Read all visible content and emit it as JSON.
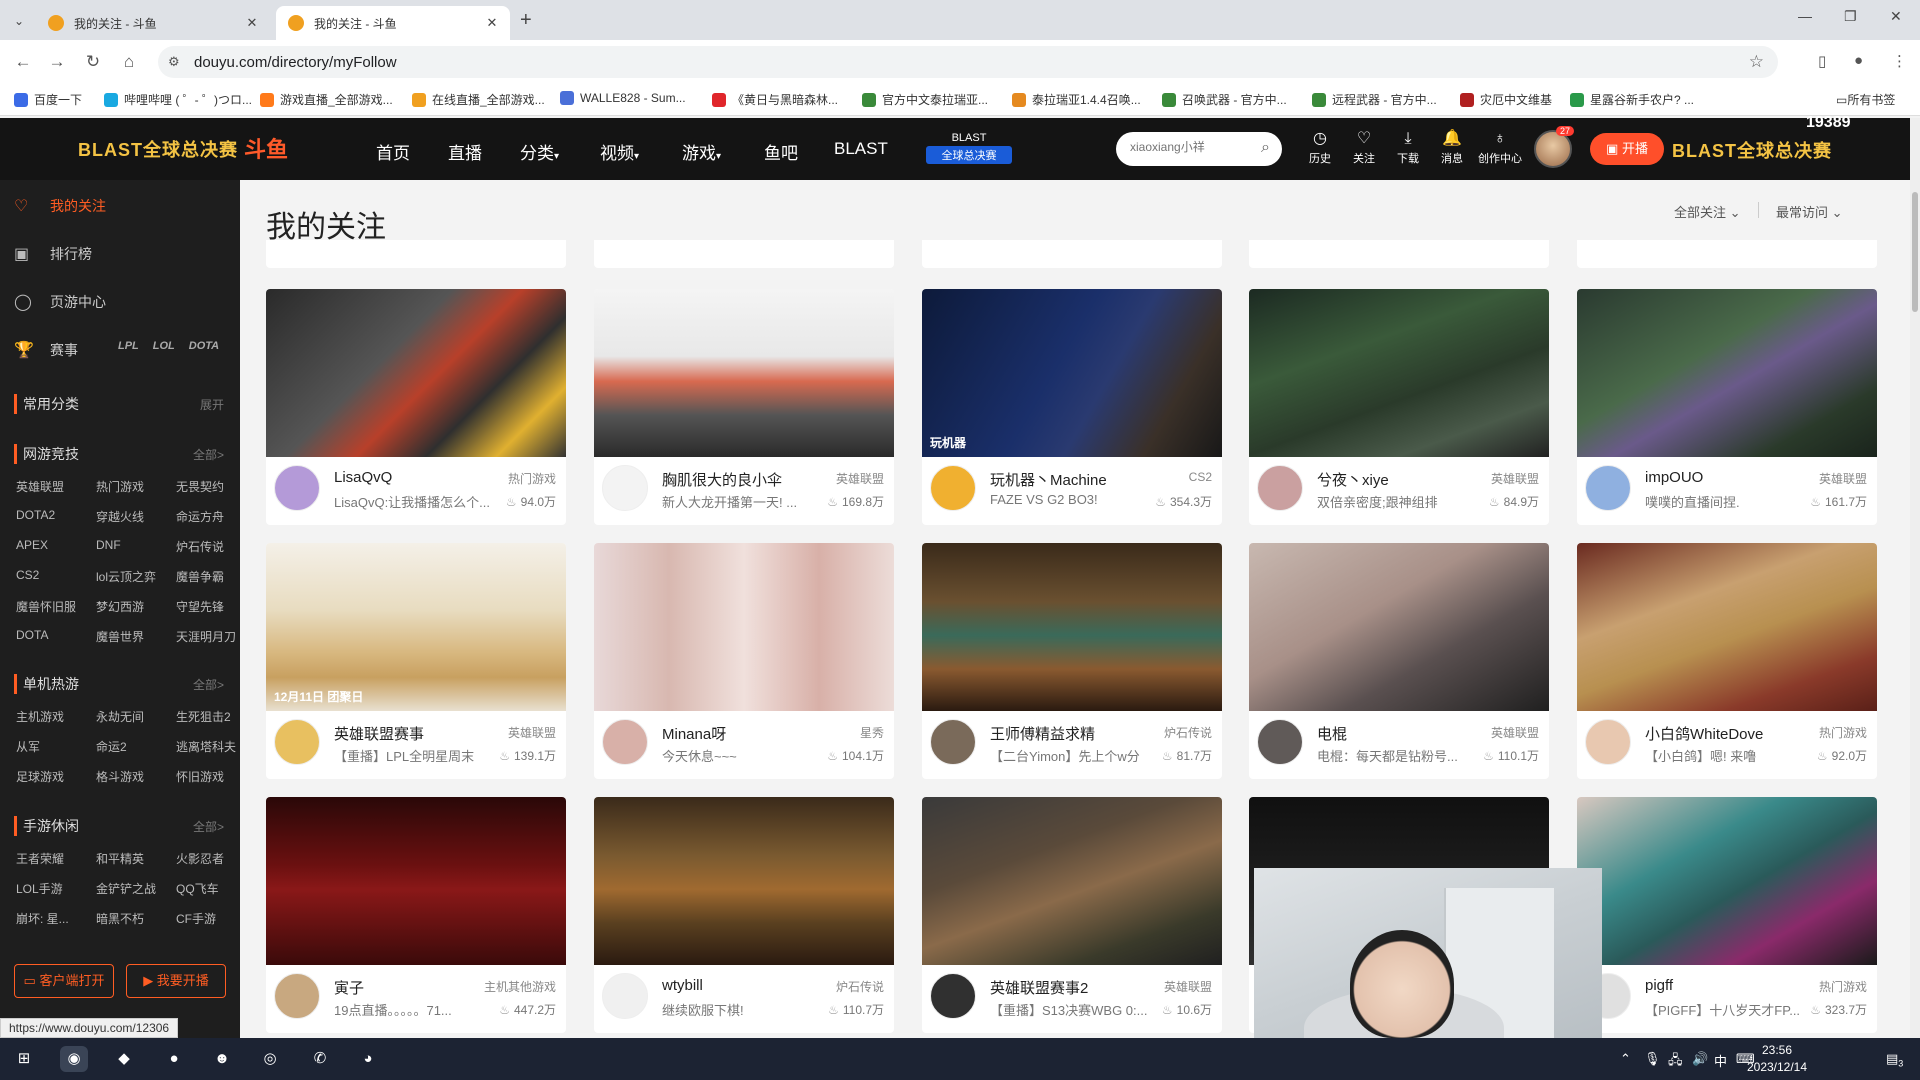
{
  "browser": {
    "tabs": [
      {
        "title": "我的关注 - 斗鱼",
        "close": "✕"
      },
      {
        "title": "我的关注 - 斗鱼",
        "close": "✕"
      }
    ],
    "new_tab": "+",
    "url": "douyu.com/directory/myFollow",
    "bookmarks": [
      {
        "label": "百度一下",
        "color": "#3b6be6"
      },
      {
        "label": "哔哩哔哩 ( ゜- ゜)つロ...",
        "color": "#19a9e1"
      },
      {
        "label": "游戏直播_全部游戏...",
        "color": "#ff7a1a"
      },
      {
        "label": "在线直播_全部游戏...",
        "color": "#f0a020"
      },
      {
        "label": "WALLE828 - Sum...",
        "color": "#4a6fd8"
      },
      {
        "label": "《黄日与黑暗森林...",
        "color": "#e0262b"
      },
      {
        "label": "官方中文泰拉瑞亚...",
        "color": "#3a8a3a"
      },
      {
        "label": "泰拉瑞亚1.4.4召唤...",
        "color": "#e58a20"
      },
      {
        "label": "召唤武器 - 官方中...",
        "color": "#3a8a3a"
      },
      {
        "label": "远程武器 - 官方中...",
        "color": "#3a8a3a"
      },
      {
        "label": "灾厄中文维基",
        "color": "#b02020"
      },
      {
        "label": "星露谷新手农户? ...",
        "color": "#2a9a4a"
      }
    ],
    "bookmarks_folder": "所有书签",
    "status_url": "https://www.douyu.com/12306"
  },
  "header": {
    "brand": "BLAST全球总决赛",
    "logo": "斗鱼",
    "nav": [
      "首页",
      "直播",
      "分类",
      "视频",
      "游戏",
      "鱼吧",
      "BLAST"
    ],
    "blast_badge_top": "BLAST",
    "blast_badge_bottom": "全球总决赛",
    "search_placeholder": "xiaoxiang小祥",
    "icons": [
      {
        "label": "历史",
        "glyph": "◷"
      },
      {
        "label": "关注",
        "glyph": "♡"
      },
      {
        "label": "下载",
        "glyph": "⤓"
      },
      {
        "label": "消息",
        "glyph": "🔔"
      },
      {
        "label": "创作中心",
        "glyph": "♁"
      }
    ],
    "avatar_badge": "27",
    "live_button": "开播",
    "brand_right": "BLAST全球总决赛",
    "corner_number": "19389"
  },
  "sidebar": {
    "items": [
      {
        "label": "我的关注",
        "glyph": "♡"
      },
      {
        "label": "排行榜",
        "glyph": "▣"
      },
      {
        "label": "页游中心",
        "glyph": "◯"
      },
      {
        "label": "赛事",
        "glyph": "🏆"
      }
    ],
    "event_logos": [
      "LPL",
      "LOL",
      "DOTA"
    ],
    "sections": [
      {
        "title": "常用分类",
        "more": "展开",
        "cats": []
      },
      {
        "title": "网游竞技",
        "more": "全部>",
        "cats": [
          "英雄联盟",
          "热门游戏",
          "无畏契约",
          "DOTA2",
          "穿越火线",
          "命运方舟",
          "APEX",
          "DNF",
          "炉石传说",
          "CS2",
          "lol云顶之弈",
          "魔兽争霸",
          "魔兽怀旧服",
          "梦幻西游",
          "守望先锋",
          "DOTA",
          "魔兽世界",
          "天涯明月刀"
        ]
      },
      {
        "title": "单机热游",
        "more": "全部>",
        "cats": [
          "主机游戏",
          "永劫无间",
          "生死狙击2",
          "从军",
          "命运2",
          "逃离塔科夫",
          "足球游戏",
          "格斗游戏",
          "怀旧游戏"
        ]
      },
      {
        "title": "手游休闲",
        "more": "全部>",
        "cats": [
          "王者荣耀",
          "和平精英",
          "火影忍者",
          "LOL手游",
          "金铲铲之战",
          "QQ飞车",
          "崩坏: 星...",
          "暗黑不朽",
          "CF手游"
        ]
      }
    ],
    "btn_client": "客户端打开",
    "btn_live": "我要开播"
  },
  "main": {
    "title": "我的关注",
    "filter_all": "全部关注",
    "filter_sort": "最常访问",
    "cards": [
      {
        "name": "LisaQvQ",
        "category": "热门游戏",
        "title": "LisaQvQ:让我播播怎么个...",
        "heat": "94.0万",
        "thumb": "thumb-1",
        "avatar": "#b49ad8"
      },
      {
        "name": "胸肌很大的良小伞",
        "category": "英雄联盟",
        "title": "新人大龙开播第一天! ...",
        "heat": "169.8万",
        "thumb": "thumb-2",
        "avatar": "#f3f3f3"
      },
      {
        "name": "玩机器丶Machine",
        "category": "CS2",
        "title": "FAZE VS G2 BO3!",
        "heat": "354.3万",
        "thumb": "thumb-3",
        "avatar": "#f0b030"
      },
      {
        "name": "兮夜丶xiye",
        "category": "英雄联盟",
        "title": "双倍亲密度;跟神组排",
        "heat": "84.9万",
        "thumb": "thumb-4",
        "avatar": "#caa0a0"
      },
      {
        "name": "impOUO",
        "category": "英雄联盟",
        "title": "噗噗的直播间捏.",
        "heat": "161.7万",
        "thumb": "thumb-5",
        "avatar": "#8fb0e0"
      },
      {
        "name": "英雄联盟赛事",
        "category": "英雄联盟",
        "title": "【重播】LPL全明星周末",
        "heat": "139.1万",
        "thumb": "thumb-6",
        "avatar": "#e8c060"
      },
      {
        "name": "Minana呀",
        "category": "星秀",
        "title": "今天休息~~~",
        "heat": "104.1万",
        "thumb": "thumb-7",
        "avatar": "#d8b0a8"
      },
      {
        "name": "王师傅精益求精",
        "category": "炉石传说",
        "title": "【二台Yimon】先上个w分",
        "heat": "81.7万",
        "thumb": "thumb-8",
        "avatar": "#7a6a5a"
      },
      {
        "name": "电棍",
        "category": "英雄联盟",
        "title": "电棍：每天都是钻粉号...",
        "heat": "110.1万",
        "thumb": "thumb-9",
        "avatar": "#605a58"
      },
      {
        "name": "小白鸽WhiteDove",
        "category": "热门游戏",
        "title": "【小白鸽】嗯! 来噜",
        "heat": "92.0万",
        "thumb": "thumb-10",
        "avatar": "#e8c8b0"
      },
      {
        "name": "寅子",
        "category": "主机其他游戏",
        "title": "19点直播。。。。。71...",
        "heat": "447.2万",
        "thumb": "thumb-11",
        "avatar": "#c8a880"
      },
      {
        "name": "wtybill",
        "category": "炉石传说",
        "title": "继续欧服下棋!",
        "heat": "110.7万",
        "thumb": "thumb-12",
        "avatar": "#f0f0f0"
      },
      {
        "name": "英雄联盟赛事2",
        "category": "英雄联盟",
        "title": "【重播】S13决赛WBG 0:...",
        "heat": "10.6万",
        "thumb": "thumb-13",
        "avatar": "#303030"
      },
      {
        "name": "",
        "category": "",
        "title": "",
        "heat": "",
        "thumb": "thumb-14",
        "avatar": "#ffffff"
      },
      {
        "name": "pigff",
        "category": "热门游戏",
        "title": "【PIGFF】十八岁天才FP...",
        "heat": "323.7万",
        "thumb": "thumb-15",
        "avatar": "#e0e0e0"
      }
    ],
    "thumb_labels": {
      "thumb-3": "玩机器",
      "thumb-6": "12月11日 团聚日"
    }
  },
  "taskbar": {
    "apps": [
      {
        "name": "windows-start-icon",
        "glyph": "⊞",
        "bg": "transparent"
      },
      {
        "name": "chrome-icon",
        "glyph": "◉",
        "bg": "#3a4456"
      },
      {
        "name": "douyu-icon",
        "glyph": "◆",
        "bg": "transparent"
      },
      {
        "name": "game-icon",
        "glyph": "●",
        "bg": "transparent"
      },
      {
        "name": "qq-icon",
        "glyph": "☻",
        "bg": "transparent"
      },
      {
        "name": "steam-icon",
        "glyph": "◎",
        "bg": "transparent"
      },
      {
        "name": "wechat-icon",
        "glyph": "✆",
        "bg": "transparent"
      },
      {
        "name": "owl-icon",
        "glyph": "◕",
        "bg": "transparent"
      }
    ],
    "time": "23:56",
    "date": "2023/12/14",
    "ime": "中",
    "notif_count": "3"
  }
}
